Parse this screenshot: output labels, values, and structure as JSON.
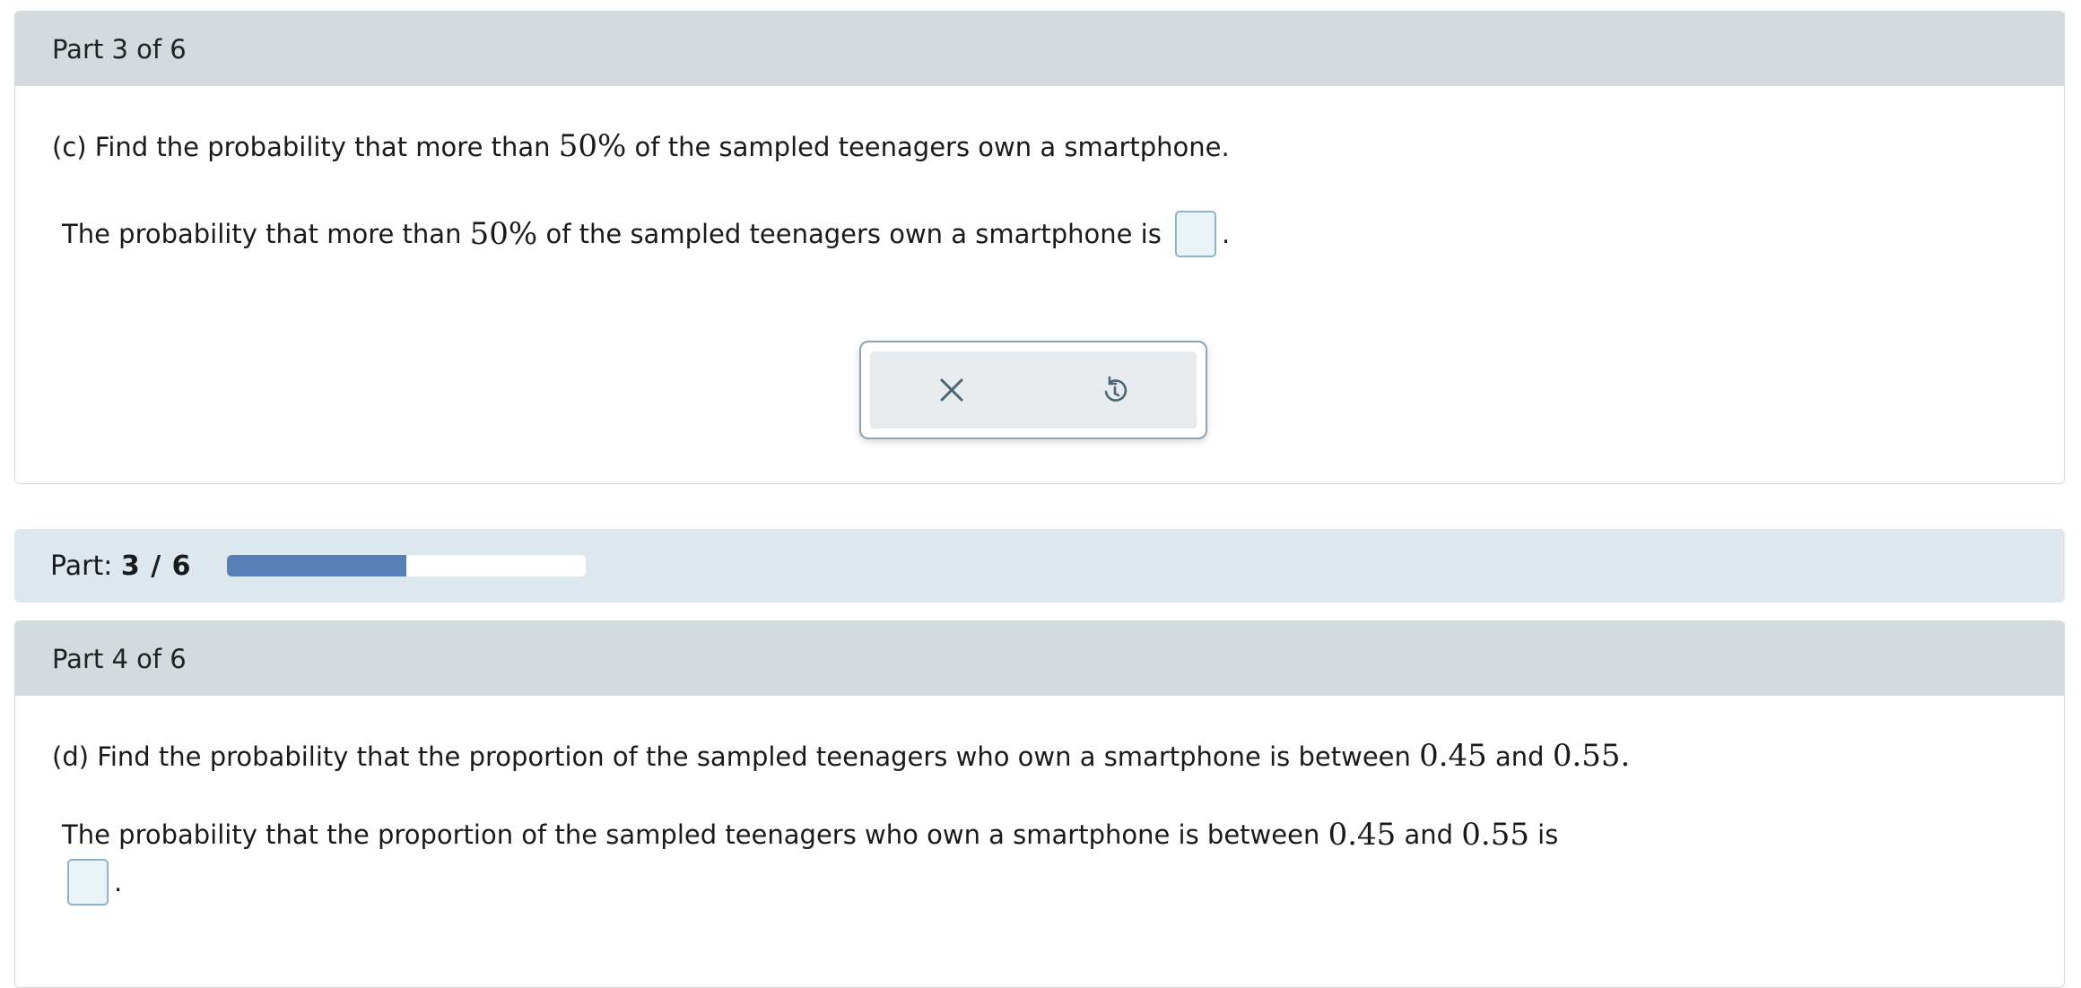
{
  "part3": {
    "header": "Part 3 of 6",
    "question": {
      "prefix": "(c) Find the probability that more than ",
      "math": "50%",
      "suffix": " of the sampled teenagers own a smartphone."
    },
    "answer": {
      "prefix": "The probability that more than ",
      "math": "50%",
      "suffix": " of the sampled teenagers own a smartphone is ",
      "value": "",
      "period": "."
    }
  },
  "tools": {
    "clear_icon": "close-icon",
    "undo_icon": "undo-icon",
    "icon_color": "#4a6672"
  },
  "progress": {
    "label": "Part: ",
    "current": "3",
    "separator": " / ",
    "total": "6",
    "fraction": 0.5,
    "fill_color": "#5680b6"
  },
  "part4": {
    "header": "Part 4 of 6",
    "question": {
      "prefix": "(d) Find the probability that the proportion of the sampled teenagers who own a smartphone is between ",
      "math1": "0.45",
      "and": " and ",
      "math2": "0.55",
      "suffix": "."
    },
    "answer": {
      "prefix": "The probability that the proportion of the sampled teenagers who own a smartphone is between ",
      "math1": "0.45",
      "and": " and ",
      "math2": "0.55",
      "suffix": " is",
      "value": "",
      "period": "."
    }
  }
}
